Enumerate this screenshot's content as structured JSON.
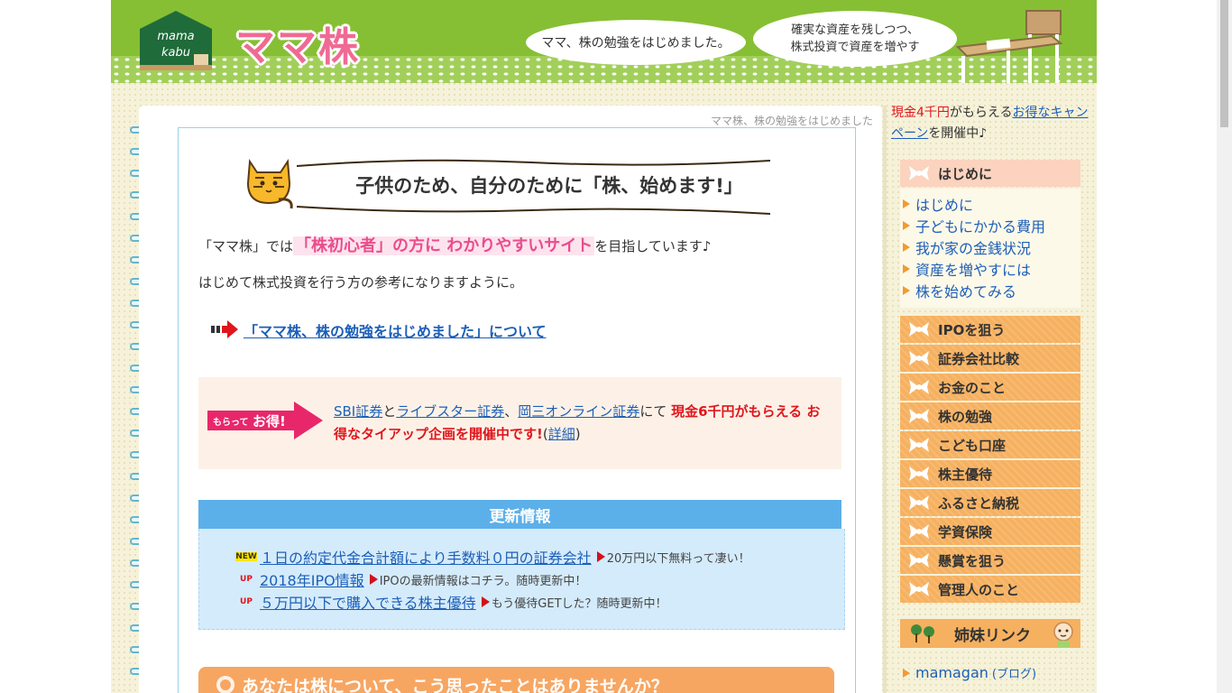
{
  "header": {
    "logo_small_line1": "mama",
    "logo_small_line2": "kabu",
    "site_title": "ママ株",
    "bubble1": "ママ、株の勉強をはじめました。",
    "bubble2_line1": "確実な資産を残しつつ、",
    "bubble2_line2": "株式投資で資産を増やす"
  },
  "main": {
    "caption": "ママ株、株の勉強をはじめました",
    "banner_title": "子供のため、自分のために「株、始めます!」",
    "intro_pre": "「ママ株」では",
    "intro_highlight": "「株初心者」の方に わかりやすいサイト",
    "intro_post": "を目指しています♪",
    "intro_line2": "はじめて株式投資を行う方の参考になりますように。",
    "about_link": "「ママ株、株の勉強をはじめました」について",
    "promo": {
      "badge_small": "もらって",
      "badge_big": "お得!",
      "link_sbi": "SBI証券",
      "and": "と",
      "link_livestar": "ライブスター証券",
      "sep": "、",
      "link_okasan": "岡三オンライン証券",
      "ni": "にて",
      "red_text": "現金6千円がもらえる お得なタイアップ企画を開催中です!",
      "detail_open": "(",
      "detail_link": "詳細",
      "detail_close": ")"
    },
    "updates_title": "更新情報",
    "updates": [
      {
        "badge": "NEW",
        "link": "１日の約定代金合計額により手数料０円の証券会社",
        "note": "20万円以下無料って凄い！"
      },
      {
        "badge": "UP",
        "link": "2018年IPO情報",
        "note": "IPOの最新情報はコチラ。随時更新中！"
      },
      {
        "badge": "UP",
        "link": "５万円以下で購入できる株主優待",
        "note": "もう優待GETした？随時更新中！"
      }
    ],
    "question_bar": "あなたは株について、こう思ったことはありませんか？"
  },
  "sidebar": {
    "campaign_red": "現金4千円",
    "campaign_mid": "がもらえる",
    "campaign_link": "お得なキャンペーン",
    "campaign_post": "を開催中♪",
    "hajime_head": "はじめに",
    "hajime_links": [
      "はじめに",
      "子どもにかかる費用",
      "我が家の金銭状況",
      "資産を増やすには",
      "株を始めてみる"
    ],
    "categories": [
      "IPOを狙う",
      "証券会社比較",
      "お金のこと",
      "株の勉強",
      "こども口座",
      "株主優待",
      "ふるさと納税",
      "学資保険",
      "懸賞を狙う",
      "管理人のこと"
    ],
    "sister_head": "姉妹リンク",
    "sister_link": "mamagan",
    "sister_note": "(ブログ)"
  },
  "colors": {
    "header_green": "#86bf34",
    "logo_pink": "#f06a93",
    "highlight_pink": "#ea4d8d",
    "link_blue": "#1d5fb8",
    "promo_red": "#e0161c",
    "updates_blue": "#5cb0e9",
    "menu_orange": "#f6b160"
  }
}
